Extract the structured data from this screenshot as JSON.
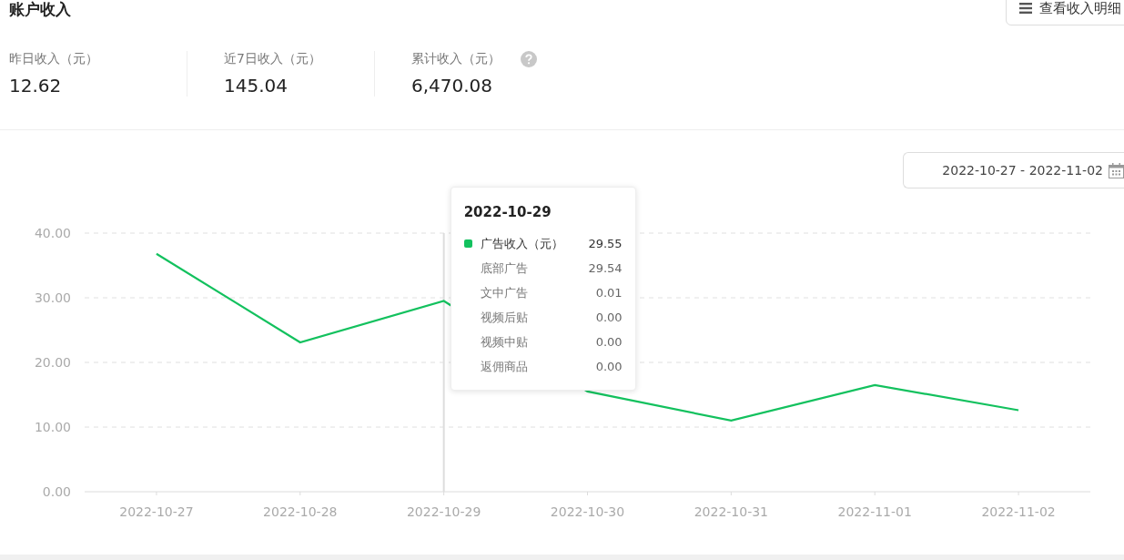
{
  "title": "账户收入",
  "detail_button": {
    "label": "查看收入明细"
  },
  "stats": [
    {
      "label": "昨日收入（元）",
      "value": "12.62",
      "help": false
    },
    {
      "label": "近7日收入（元）",
      "value": "145.04",
      "help": false
    },
    {
      "label": "累计收入（元）",
      "value": "6,470.08",
      "help": true
    }
  ],
  "date_range": {
    "value": "2022-10-27 - 2022-11-02"
  },
  "chart": {
    "chart_data": {
      "type": "line",
      "categories": [
        "2022-10-27",
        "2022-10-28",
        "2022-10-29",
        "2022-10-30",
        "2022-10-31",
        "2022-11-01",
        "2022-11-02"
      ],
      "ylim": [
        0,
        40
      ],
      "yticks": [
        {
          "value": 0,
          "label": "0.00"
        },
        {
          "value": 10,
          "label": "10.00"
        },
        {
          "value": 20,
          "label": "20.00"
        },
        {
          "value": 30,
          "label": "30.00"
        },
        {
          "value": 40,
          "label": "40.00"
        }
      ],
      "grid": true,
      "ref_lines": [
        {
          "axis": "x",
          "value": "2022-10-29"
        }
      ],
      "series": [
        {
          "name": "广告收入（元）",
          "color": "#13c15e",
          "values": [
            36.8,
            23.1,
            29.5,
            15.5,
            11,
            16.5,
            12.6
          ]
        }
      ]
    },
    "tooltip": {
      "title": "2022-10-29",
      "rows": [
        {
          "kind": "series",
          "value": "29.55"
        },
        {
          "label": "底部广告",
          "value": "29.54"
        },
        {
          "label": "文中广告",
          "value": "0.01"
        },
        {
          "label": "视频后贴",
          "value": "0.00"
        },
        {
          "label": "视频中贴",
          "value": "0.00"
        },
        {
          "label": "返佣商品",
          "value": "0.00"
        }
      ]
    }
  }
}
